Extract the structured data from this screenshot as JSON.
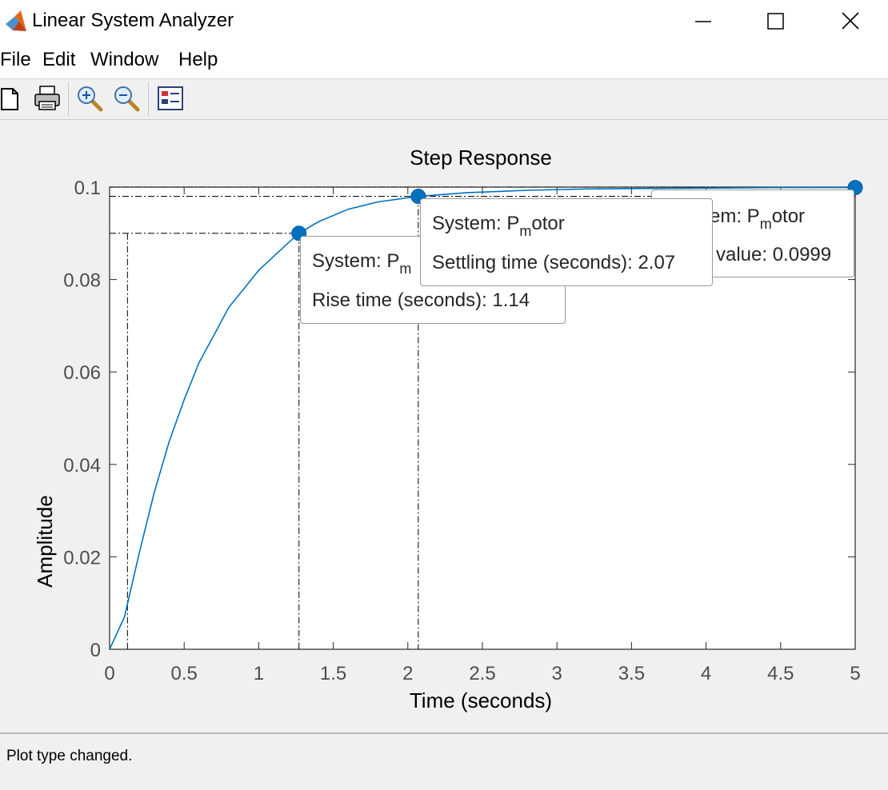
{
  "window": {
    "title": "Linear System Analyzer",
    "controls": [
      "minimize-icon",
      "maximize-icon",
      "close-icon"
    ]
  },
  "menu": {
    "file": "File",
    "edit": "Edit",
    "window": "Window",
    "help": "Help"
  },
  "toolbar": {
    "icons": [
      "new-document-icon",
      "print-icon",
      "zoom-in-icon",
      "zoom-out-icon",
      "plot-configuration-icon"
    ]
  },
  "chart_data": {
    "type": "line",
    "title": "Step Response",
    "xlabel": "Time (seconds)",
    "ylabel": "Amplitude",
    "xlim": [
      0,
      5
    ],
    "ylim": [
      0,
      0.1
    ],
    "x_ticks": [
      "0",
      "0.5",
      "1",
      "1.5",
      "2",
      "2.5",
      "3",
      "3.5",
      "4",
      "4.5",
      "5"
    ],
    "y_ticks": [
      "0",
      "0.02",
      "0.04",
      "0.06",
      "0.08",
      "0.1"
    ],
    "series": [
      {
        "color": "#0072bd",
        "x": [
          0,
          0.1,
          0.2,
          0.3,
          0.4,
          0.5,
          0.6,
          0.7,
          0.8,
          0.9,
          1.0,
          1.1,
          1.2,
          1.27,
          1.4,
          1.6,
          1.8,
          2.07,
          2.4,
          2.8,
          3.2,
          3.6,
          4.0,
          4.5,
          5.0
        ],
        "y": [
          0,
          0.007,
          0.021,
          0.034,
          0.045,
          0.054,
          0.062,
          0.068,
          0.074,
          0.078,
          0.082,
          0.085,
          0.088,
          0.09,
          0.0925,
          0.0952,
          0.0968,
          0.098,
          0.0988,
          0.0993,
          0.0996,
          0.0997,
          0.0998,
          0.0999,
          0.0999
        ]
      }
    ],
    "markers": {
      "rise": {
        "start_x": 0.12,
        "x": 1.27,
        "y": 0.09
      },
      "settling": {
        "x": 2.07,
        "y": 0.098
      },
      "steady": {
        "x": 5.0,
        "y": 0.0999
      }
    },
    "datatips": {
      "rise": {
        "system_prefix": "System: P",
        "system_sub": "m",
        "system_suffix": "",
        "line2": "Rise time (seconds): 1.14"
      },
      "settling": {
        "system_prefix": "System: P",
        "system_sub": "m",
        "system_suffix": "otor",
        "line2": "Settling time (seconds): 2.07"
      },
      "steady": {
        "system_prefix": "em: P",
        "system_sub": "m",
        "system_suffix": "otor",
        "line2": "value: 0.0999"
      }
    }
  },
  "status": {
    "text": "Plot type changed."
  }
}
